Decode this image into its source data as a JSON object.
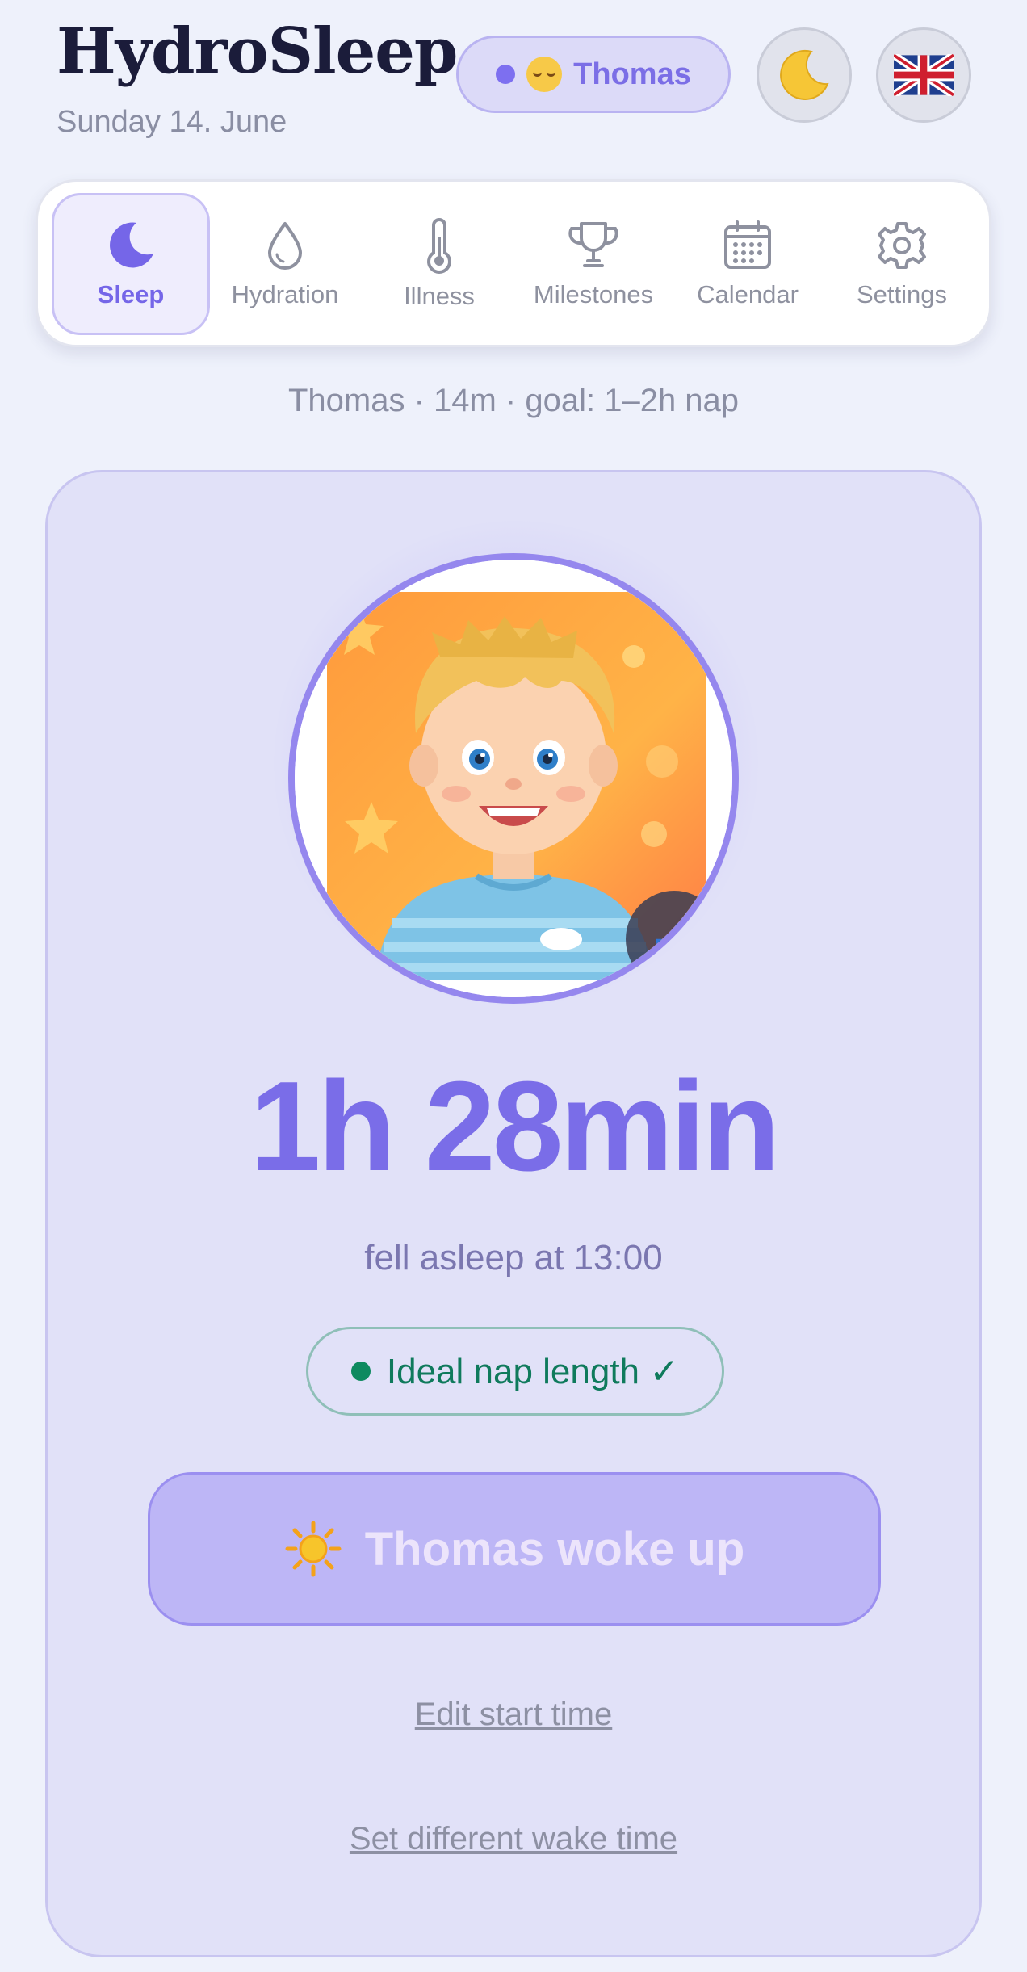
{
  "header": {
    "app_title": "HydroSleep",
    "date": "Sunday 14. June",
    "profile_name": "Thomas",
    "theme_icon": "moon-icon",
    "language_icon": "uk-flag-icon"
  },
  "tabs": [
    {
      "label": "Sleep",
      "icon": "moon-icon",
      "active": true
    },
    {
      "label": "Hydration",
      "icon": "drop-icon",
      "active": false
    },
    {
      "label": "Illness",
      "icon": "thermometer-icon",
      "active": false
    },
    {
      "label": "Milestones",
      "icon": "trophy-icon",
      "active": false
    },
    {
      "label": "Calendar",
      "icon": "calendar-icon",
      "active": false
    },
    {
      "label": "Settings",
      "icon": "gear-icon",
      "active": false
    }
  ],
  "child_info": "Thomas · 14m · goal: 1–2h nap",
  "sleep_card": {
    "duration": "1h 28min",
    "fell_asleep": "fell asleep at 13:00",
    "status_badge": "Ideal nap length ✓",
    "wake_button": "Thomas woke up",
    "edit_start_link": "Edit start time",
    "set_wake_link": "Set different wake time"
  },
  "colors": {
    "accent": "#7a6de8",
    "background": "#eef1fb",
    "card": "#e1e1f8",
    "success": "#0f7a5c"
  }
}
